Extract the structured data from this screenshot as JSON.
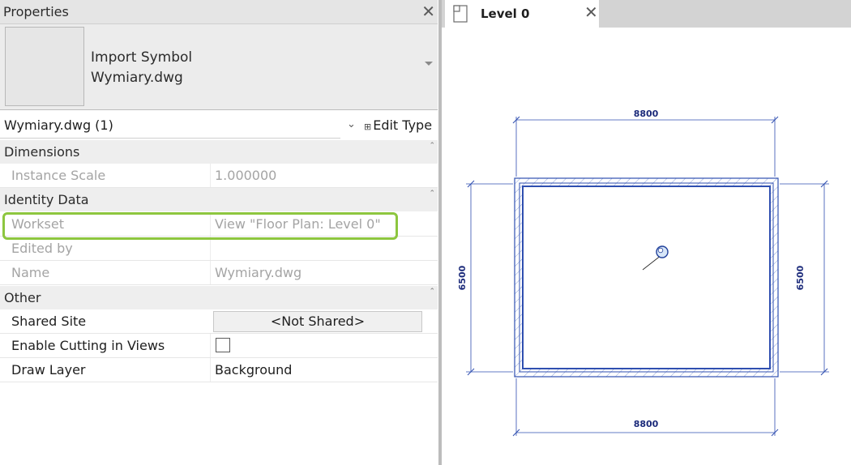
{
  "properties": {
    "title": "Properties",
    "type_selector": {
      "line1": "Import Symbol",
      "line2": "Wymiary.dwg"
    },
    "instance_filter": "Wymiary.dwg (1)",
    "edit_type_label": "Edit Type",
    "groups": {
      "dimensions": {
        "label": "Dimensions",
        "instance_scale": {
          "key": "Instance Scale",
          "value": "1.000000"
        }
      },
      "identity_data": {
        "label": "Identity Data",
        "workset": {
          "key": "Workset",
          "value": "View \"Floor Plan: Level 0\""
        },
        "edited_by": {
          "key": "Edited by",
          "value": ""
        },
        "name": {
          "key": "Name",
          "value": "Wymiary.dwg"
        }
      },
      "other": {
        "label": "Other",
        "shared_site": {
          "key": "Shared Site",
          "value": "<Not Shared>"
        },
        "enable_cutting": {
          "key": "Enable Cutting in Views",
          "checked": false
        },
        "draw_layer": {
          "key": "Draw Layer",
          "value": "Background"
        }
      }
    }
  },
  "view": {
    "tab_label": "Level 0",
    "dimensions": {
      "top": "8800",
      "bottom": "8800",
      "left": "6500",
      "right": "6500"
    }
  },
  "colors": {
    "highlight": "#8dc63f",
    "drawing_line": "#2f4fb0",
    "dimension_text": "#1b2a7a"
  },
  "icons": [
    "close-icon",
    "dropdown-arrow-icon",
    "chevron-down-icon",
    "edit-type-icon",
    "collapse-icon",
    "view-tab-icon",
    "survey-point-icon"
  ]
}
